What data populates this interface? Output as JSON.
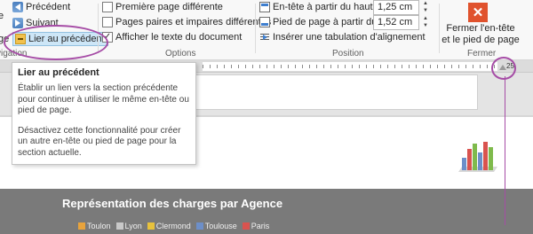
{
  "ribbon": {
    "navigation": {
      "previous_label": "Précédent",
      "next_label": "Suivant",
      "link_previous_label": "Lier au précédent",
      "partial_left_label": "e",
      "partial_left_label2": "ge",
      "group_label_partial": "vigation"
    },
    "options": {
      "different_first_page": "Première page différente",
      "different_odd_even": "Pages paires et impaires différentes",
      "show_document_text": "Afficher le texte du document",
      "different_first_page_checked": false,
      "different_odd_even_checked": false,
      "show_document_text_checked": true,
      "group_label": "Options"
    },
    "position": {
      "header_from_top_label": "En-tête à partir du haut :",
      "header_from_top_value": "1,25 cm",
      "footer_from_bottom_label": "Pied de page à partir du bas :",
      "footer_from_bottom_value": "1,52 cm",
      "insert_tab_label": "Insérer une tabulation d'alignement",
      "group_label": "Position"
    },
    "close": {
      "button_label_line1": "Fermer l'en-tête",
      "button_label_line2": "et le pied de page",
      "group_label": "Fermer"
    }
  },
  "ruler": {
    "marker": "25"
  },
  "tooltip": {
    "title": "Lier au précédent",
    "paragraph1": "Établir un lien vers la section précédente pour continuer à utiliser le même en-tête ou pied de page.",
    "paragraph2": "Désactivez cette fonctionnalité pour créer un autre en-tête ou pied de page pour la section actuelle."
  },
  "document": {
    "band_title": "Représentation des charges par Agence",
    "legend": [
      {
        "label": "Toulon",
        "color": "#e8a33c"
      },
      {
        "label": "Lyon",
        "color": "#c9c9c9"
      },
      {
        "label": "Clermond",
        "color": "#e8c23c"
      },
      {
        "label": "Toulouse",
        "color": "#6d8fc9"
      },
      {
        "label": "Paris",
        "color": "#d9534f"
      }
    ]
  },
  "colors": {
    "annotation": "#a64ca6",
    "close_button": "#e0522d",
    "selected_button": "#cde6f7"
  }
}
